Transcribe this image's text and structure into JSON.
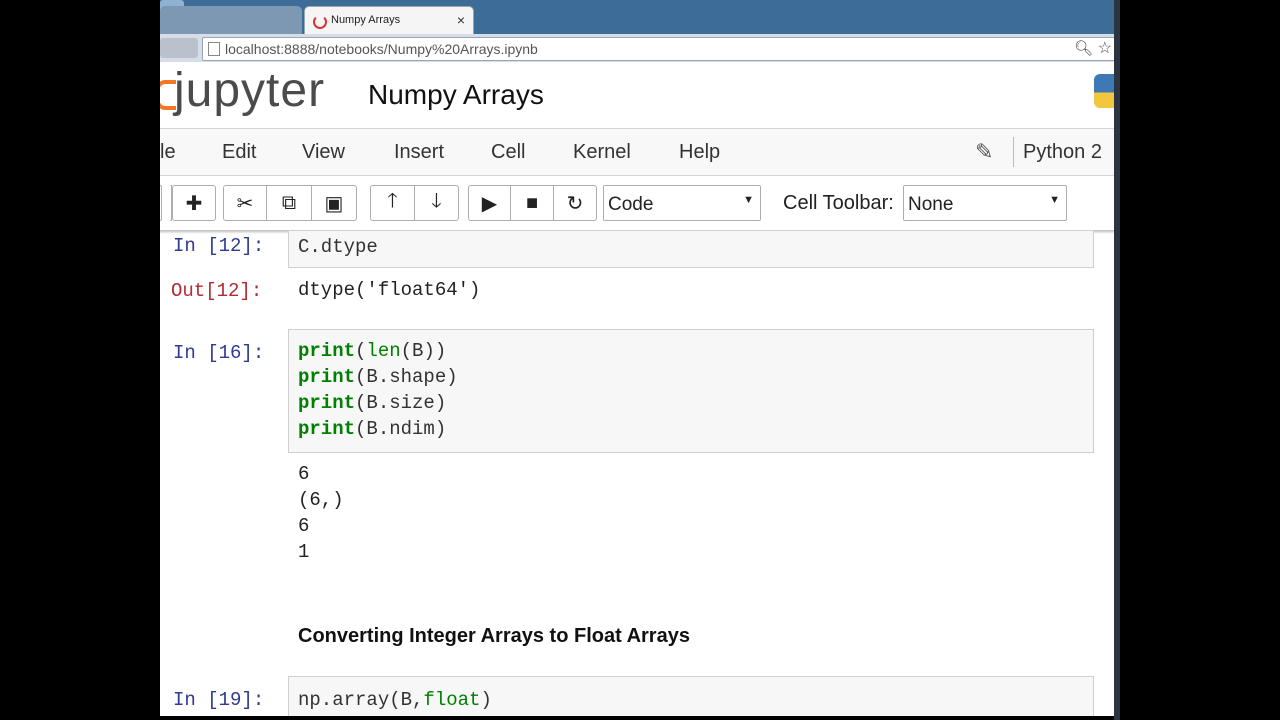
{
  "browser": {
    "tab_title": "Numpy Arrays",
    "url": "localhost:8888/notebooks/Numpy%20Arrays.ipynb"
  },
  "header": {
    "logo_text": "jupyter",
    "notebook_name": "Numpy Arrays",
    "colors": {
      "logo_orange": "#f37726"
    }
  },
  "menu": {
    "items": [
      "le",
      "Edit",
      "View",
      "Insert",
      "Cell",
      "Kernel",
      "Help"
    ],
    "kernel_name": "Python 2"
  },
  "toolbar": {
    "cell_type": "Code",
    "cell_toolbar_label": "Cell Toolbar:",
    "cell_toolbar_value": "None",
    "icons": [
      "save-icon",
      "add-icon",
      "cut-icon",
      "copy-icon",
      "paste-icon",
      "move-up-icon",
      "move-down-icon",
      "run-icon",
      "stop-icon",
      "restart-icon"
    ]
  },
  "cells": {
    "c12": {
      "in_prompt": "In [12]:",
      "code": "C.dtype",
      "out_prompt": "Out[12]:",
      "output": "dtype('float64')"
    },
    "c16": {
      "in_prompt": "In [16]:",
      "lines": [
        {
          "fn": "print",
          "open": "(",
          "inner_fn": "len",
          "rest": "(B))"
        },
        {
          "fn": "print",
          "rest": "(B.shape)"
        },
        {
          "fn": "print",
          "rest": "(B.size)"
        },
        {
          "fn": "print",
          "rest": "(B.ndim)"
        }
      ],
      "output": [
        "6",
        "(6,)",
        "6",
        "1"
      ]
    },
    "heading": "Converting Integer Arrays to Float Arrays",
    "c19": {
      "in_prompt": "In [19]:",
      "code_pre": "np.array(B,",
      "code_kw": "float",
      "code_post": ")"
    }
  }
}
